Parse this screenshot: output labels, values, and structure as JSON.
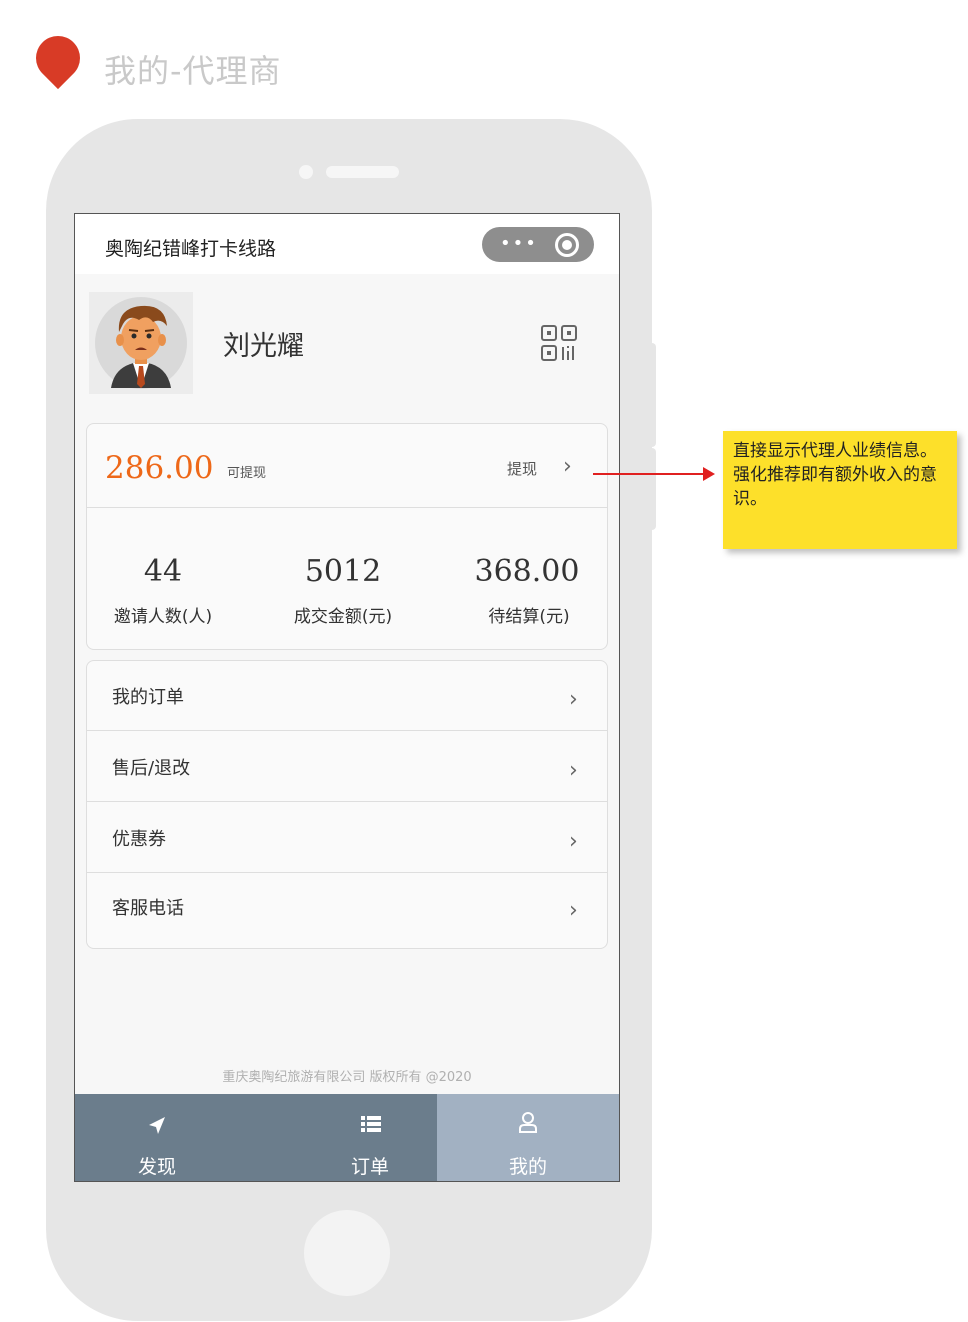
{
  "page": {
    "title": "我的-代理商"
  },
  "miniapp": {
    "title": "奥陶纪错峰打卡线路",
    "menu_dots": "•••"
  },
  "profile": {
    "name": "刘光耀",
    "avatar_icon": "avatar-icon",
    "qr_icon": "qrcode-icon"
  },
  "wallet": {
    "balance": "286.00",
    "balance_label": "可提现",
    "withdraw_label": "提现",
    "stats": [
      {
        "value": "44",
        "label": "邀请人数(人)"
      },
      {
        "value": "5012",
        "label": "成交金额(元)"
      },
      {
        "value": "368.00",
        "label": "待结算(元)"
      }
    ]
  },
  "menu": [
    {
      "label": "我的订单"
    },
    {
      "label": "售后/退改"
    },
    {
      "label": "优惠券"
    },
    {
      "label": "客服电话"
    }
  ],
  "chevron": "›",
  "footer": {
    "text": "重庆奥陶纪旅游有限公司  版权所有    @2020"
  },
  "tabs": [
    {
      "label": "发现",
      "icon": "navigation-arrow-icon",
      "active": false
    },
    {
      "label": "订单",
      "icon": "list-icon",
      "active": false
    },
    {
      "label": "我的",
      "icon": "user-icon",
      "active": true
    }
  ],
  "annotation": {
    "text": "直接显示代理人业绩信息。强化推荐即有额外收入的意识。"
  },
  "colors": {
    "accent": "#ee6818",
    "tabbar": "#6b7d8c",
    "tab_active": "#a2b1c2",
    "note": "#fde02a",
    "arrow": "#e02020",
    "pin": "#d83b26"
  }
}
